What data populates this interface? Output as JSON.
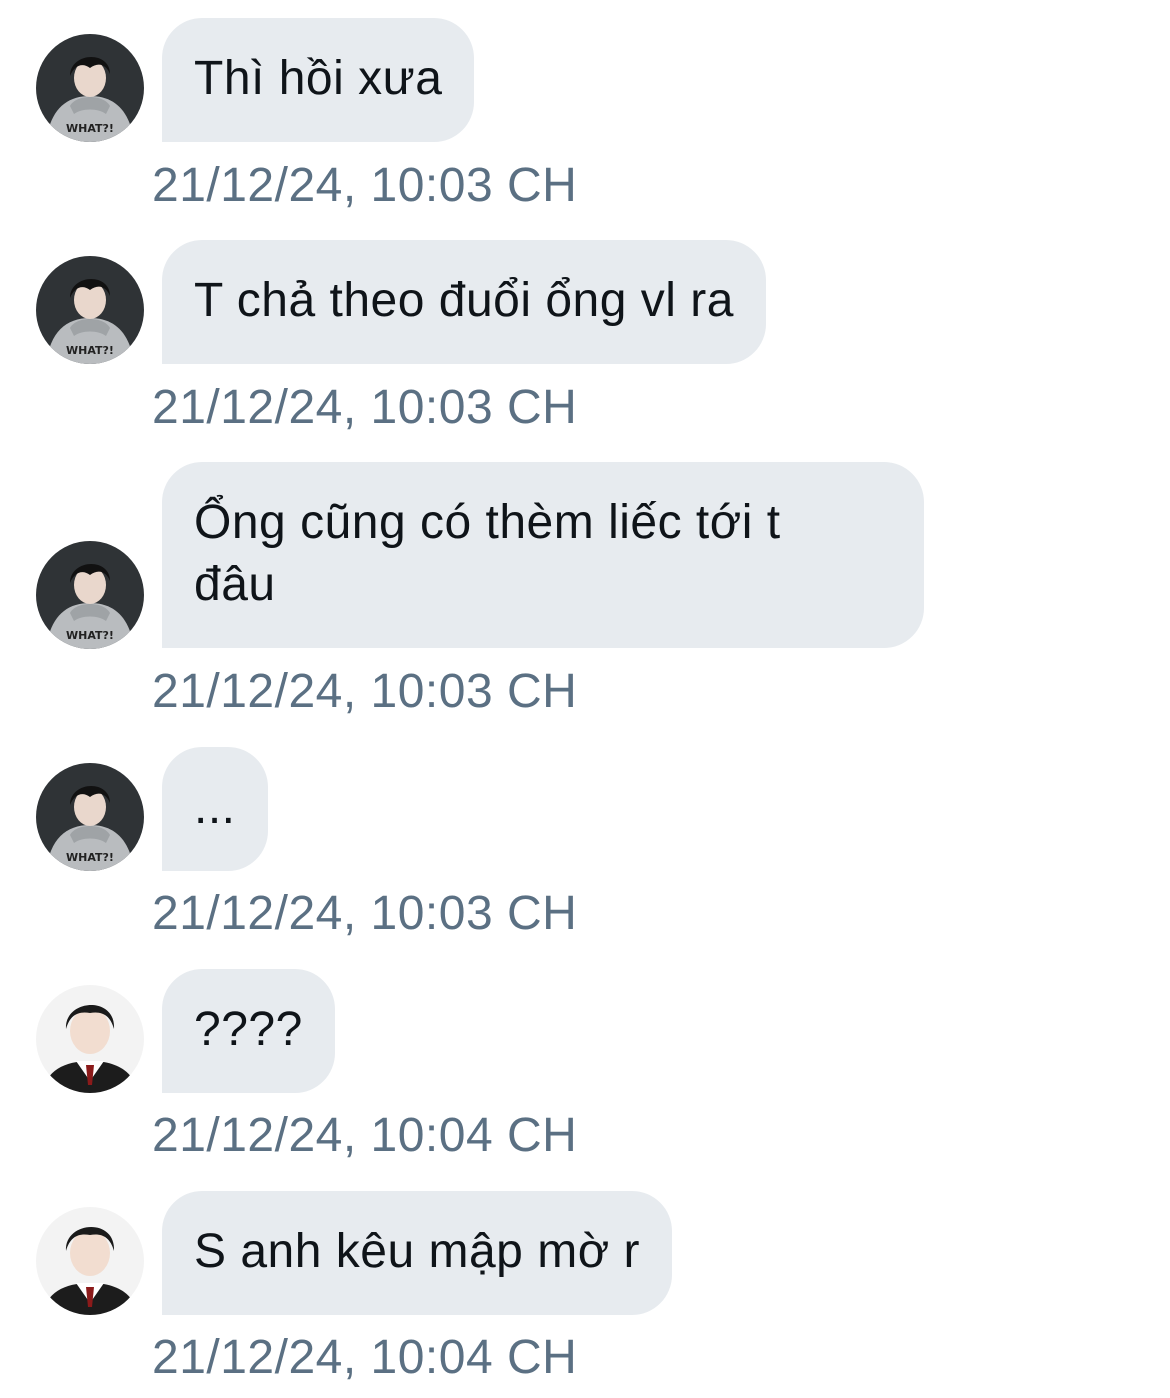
{
  "messages": [
    {
      "sender": "A",
      "text": "Thì hồi xưa",
      "time": "21/12/24, 10:03 CH"
    },
    {
      "sender": "A",
      "text": "T chả theo đuổi ổng vl ra",
      "time": "21/12/24, 10:03 CH"
    },
    {
      "sender": "A",
      "text": "Ổng cũng có thèm liếc tới t\nđâu",
      "time": "21/12/24, 10:03 CH"
    },
    {
      "sender": "A",
      "text": "...",
      "time": "21/12/24, 10:03 CH"
    },
    {
      "sender": "B",
      "text": "????",
      "time": "21/12/24, 10:04 CH"
    },
    {
      "sender": "B",
      "text": "S anh kêu mập mờ r",
      "time": "21/12/24, 10:04 CH"
    }
  ],
  "avatars": {
    "A": {
      "icon": "avatar-grey-hoodie",
      "hoodie_print": "WHAT?!"
    },
    "B": {
      "icon": "avatar-school-uniform"
    }
  },
  "colors": {
    "bubble": "#e7ebef",
    "message_text": "#0f1419",
    "timestamp": "#5b7083",
    "background": "#ffffff"
  }
}
